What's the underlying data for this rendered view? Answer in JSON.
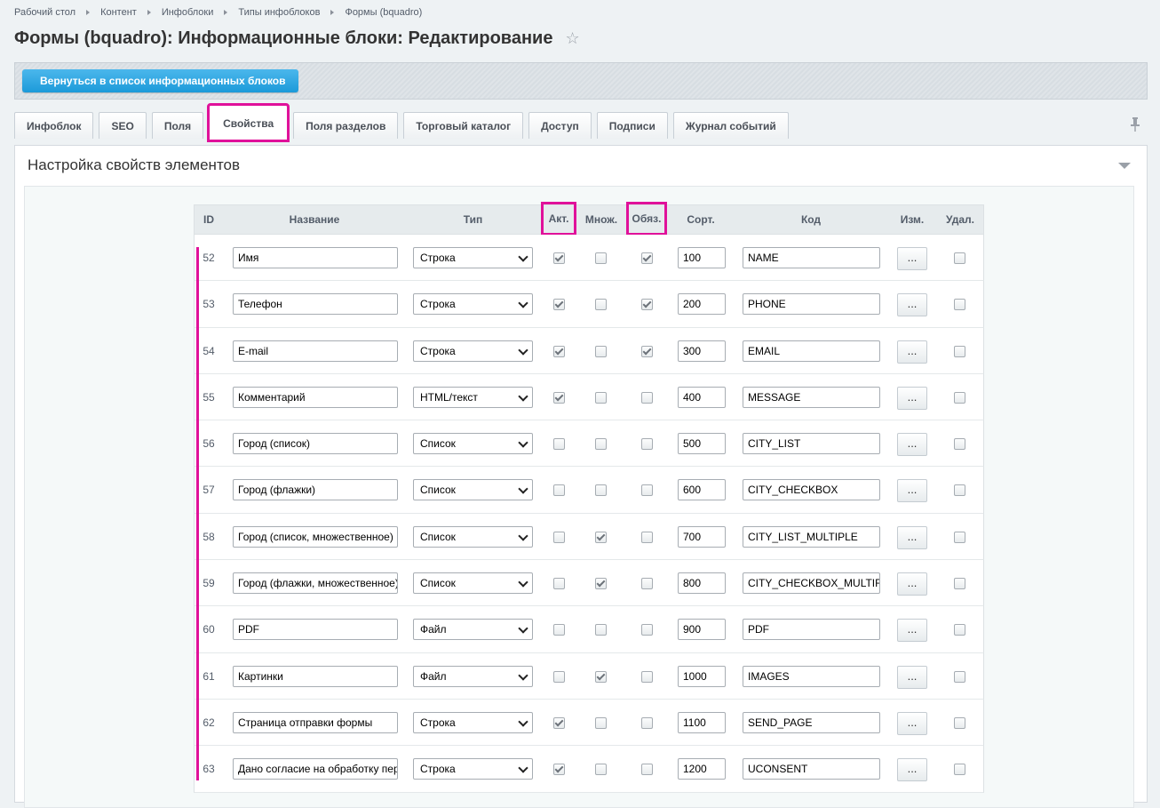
{
  "breadcrumb": [
    "Рабочий стол",
    "Контент",
    "Инфоблоки",
    "Типы инфоблоков",
    "Формы (bquadro)"
  ],
  "page_title": "Формы (bquadro): Информационные блоки: Редактирование",
  "back_button": "Вернуться в список информационных блоков",
  "tabs": [
    "Инфоблок",
    "SEO",
    "Поля",
    "Свойства",
    "Поля разделов",
    "Торговый каталог",
    "Доступ",
    "Подписи",
    "Журнал событий"
  ],
  "active_tab": "Свойства",
  "panel_title": "Настройка свойств элементов",
  "columns": {
    "id": "ID",
    "name": "Название",
    "type": "Тип",
    "active": "Акт.",
    "multiple": "Множ.",
    "required": "Обяз.",
    "sort": "Сорт.",
    "code": "Код",
    "edit": "Изм.",
    "delete": "Удал."
  },
  "edit_button_label": "...",
  "colors": {
    "accent": "#e0119a",
    "button": "#1c9ad9"
  },
  "rows": [
    {
      "id": "52",
      "name": "Имя",
      "type": "Строка",
      "active": true,
      "multiple": false,
      "required": true,
      "sort": "100",
      "code": "NAME"
    },
    {
      "id": "53",
      "name": "Телефон",
      "type": "Строка",
      "active": true,
      "multiple": false,
      "required": true,
      "sort": "200",
      "code": "PHONE"
    },
    {
      "id": "54",
      "name": "E-mail",
      "type": "Строка",
      "active": true,
      "multiple": false,
      "required": true,
      "sort": "300",
      "code": "EMAIL"
    },
    {
      "id": "55",
      "name": "Комментарий",
      "type": "HTML/текст",
      "active": true,
      "multiple": false,
      "required": false,
      "sort": "400",
      "code": "MESSAGE"
    },
    {
      "id": "56",
      "name": "Город (список)",
      "type": "Список",
      "active": false,
      "multiple": false,
      "required": false,
      "sort": "500",
      "code": "CITY_LIST"
    },
    {
      "id": "57",
      "name": "Город (флажки)",
      "type": "Список",
      "active": false,
      "multiple": false,
      "required": false,
      "sort": "600",
      "code": "CITY_CHECKBOX"
    },
    {
      "id": "58",
      "name": "Город (список, множественное)",
      "type": "Список",
      "active": false,
      "multiple": true,
      "required": false,
      "sort": "700",
      "code": "CITY_LIST_MULTIPLE"
    },
    {
      "id": "59",
      "name": "Город (флажки, множественное)",
      "type": "Список",
      "active": false,
      "multiple": true,
      "required": false,
      "sort": "800",
      "code": "CITY_CHECKBOX_MULTIF"
    },
    {
      "id": "60",
      "name": "PDF",
      "type": "Файл",
      "active": false,
      "multiple": false,
      "required": false,
      "sort": "900",
      "code": "PDF"
    },
    {
      "id": "61",
      "name": "Картинки",
      "type": "Файл",
      "active": false,
      "multiple": true,
      "required": false,
      "sort": "1000",
      "code": "IMAGES"
    },
    {
      "id": "62",
      "name": "Страница отправки формы",
      "type": "Строка",
      "active": true,
      "multiple": false,
      "required": false,
      "sort": "1100",
      "code": "SEND_PAGE"
    },
    {
      "id": "63",
      "name": "Дано согласие на обработку пер",
      "type": "Строка",
      "active": true,
      "multiple": false,
      "required": false,
      "sort": "1200",
      "code": "UCONSENT"
    }
  ]
}
